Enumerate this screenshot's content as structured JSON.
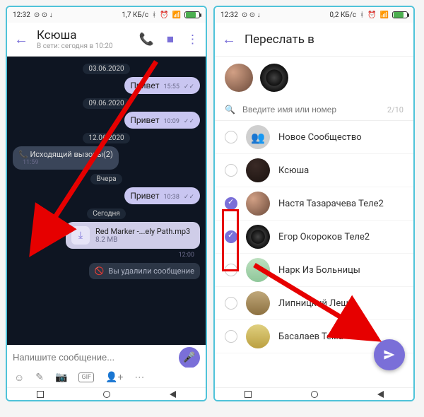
{
  "left": {
    "status": {
      "time": "12:32",
      "net": "1,7 КБ/с",
      "battery": "76"
    },
    "header": {
      "name": "Ксюша",
      "status": "В сети: сегодня в 10:20"
    },
    "dates": {
      "d1": "03.06.2020",
      "d2": "09.06.2020",
      "d3": "12.06.2020",
      "d4": "Вчера",
      "d5": "Сегодня"
    },
    "msgs": {
      "hi1": "Привет",
      "t1": "15:55",
      "hi2": "Привет",
      "t2": "10:09",
      "calls": "Исходящий вызовы(2)",
      "tcalls": "11:59",
      "hi3": "Привет",
      "t3": "10:38",
      "file_name": "Red Marker -...ely Path.mp3",
      "file_size": "8.2 MB",
      "tfile": "12:00",
      "deleted": "Вы удалили сообщение"
    },
    "input_placeholder": "Напишите сообщение..."
  },
  "right": {
    "status": {
      "time": "12:32",
      "net": "0,2 КБ/с",
      "battery": "76"
    },
    "header": {
      "title": "Переслать в"
    },
    "search_placeholder": "Введите имя или номер",
    "counter": "2/10",
    "contacts": [
      {
        "name": "Новое Сообщество",
        "checked": false,
        "avatar": "grp"
      },
      {
        "name": "Ксюша",
        "checked": false,
        "avatar": "ks"
      },
      {
        "name": "Настя Тазарачева Теле2",
        "checked": true,
        "avatar": "na"
      },
      {
        "name": "Егор Окороков Теле2",
        "checked": true,
        "avatar": "eg"
      },
      {
        "name": "Нарк Из Больницы",
        "checked": false,
        "avatar": "ho"
      },
      {
        "name": "Липницкий Леша",
        "checked": false,
        "avatar": "li"
      },
      {
        "name": "Басалаев Тема",
        "checked": false,
        "avatar": "ba"
      }
    ]
  }
}
